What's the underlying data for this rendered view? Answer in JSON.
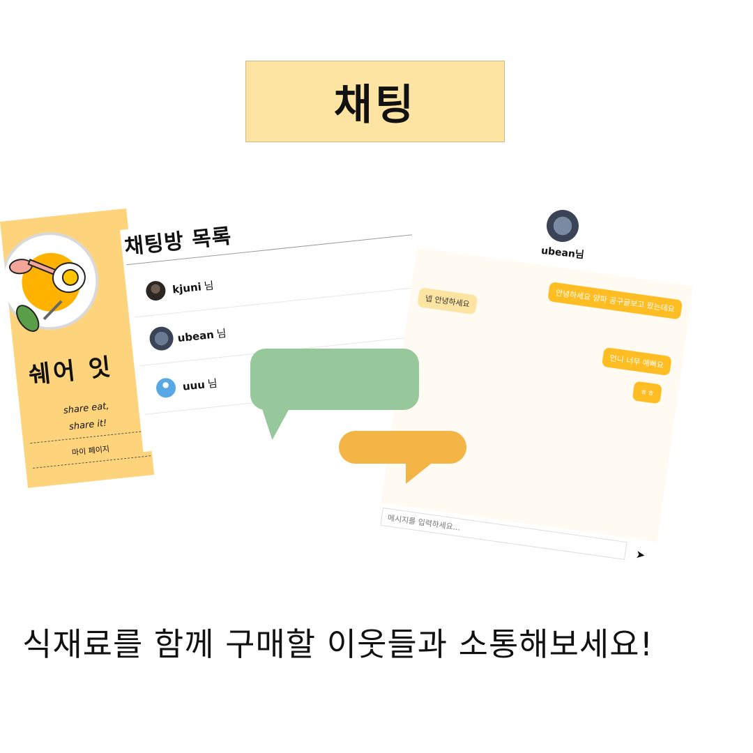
{
  "header": {
    "title": "채팅"
  },
  "sidebar": {
    "logo_text": "쉐어 잇",
    "slogan_line1": "share eat,",
    "slogan_line2": "share it!",
    "menu_item": "마이 페이지"
  },
  "chat_list": {
    "title": "채팅방 목록",
    "rooms": [
      {
        "name": "kjuni",
        "suffix": "님"
      },
      {
        "name": "ubean",
        "suffix": "님"
      },
      {
        "name": "uuu",
        "suffix": "님"
      }
    ]
  },
  "chat_window": {
    "partner_name": "ubean님",
    "messages": [
      {
        "from": "me",
        "text": "안녕하세요 양파 공구글보고 왔는데요"
      },
      {
        "from": "other",
        "text": "넵 안녕하세요"
      },
      {
        "from": "me",
        "text": "언니 너무 예뻐요"
      },
      {
        "from": "me",
        "text": "ㅎㅎ"
      }
    ],
    "input_placeholder": "메시지를 입력하세요...",
    "send_icon": "send-icon"
  },
  "colors": {
    "title_bg": "#fde4a3",
    "sidebar_bg": "#fdd47b",
    "my_message": "#ffbd24",
    "other_message": "#fde4a3",
    "green_bubble": "#97c89c",
    "orange_bubble": "#f4b547"
  },
  "caption": "식재료를 함께 구매할 이웃들과 소통해보세요!"
}
